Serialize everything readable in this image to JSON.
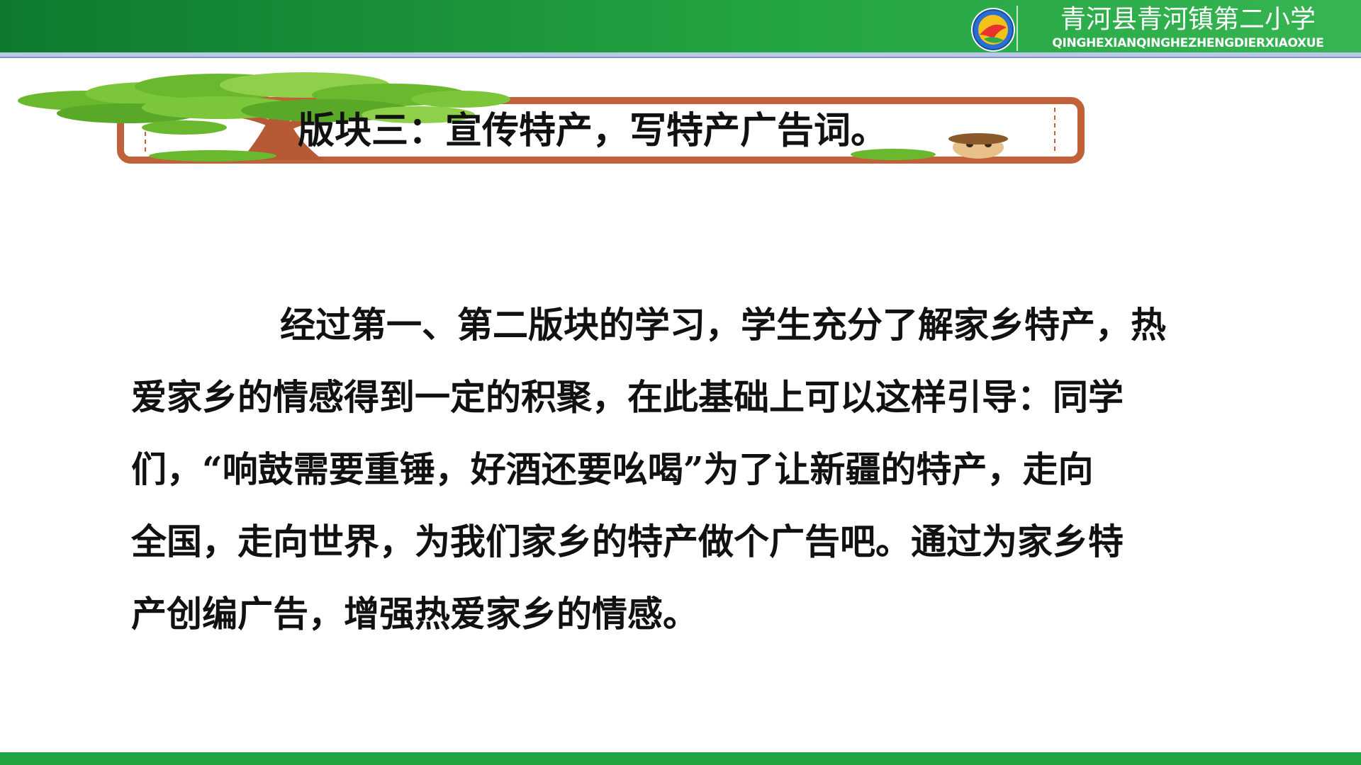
{
  "header": {
    "school_name": "青河县青河镇第二小学",
    "school_pinyin": "QINGHEXIANQINGHEZHENGDIERXIAOXUE",
    "logo_icon": "school-emblem-icon",
    "bar_color": "#23a442"
  },
  "banner": {
    "title": "版块三：宣传特产，写特产广告词。",
    "frame_color": "#c0613a",
    "tree_color": "#6ab82e"
  },
  "body": {
    "lines": [
      "经过第一、第二版块的学习，学生充分了解家乡特产，热",
      "爱家乡的情感得到一定的积聚，在此基础上可以这样引导：同学",
      "们，“响鼓需要重锤，好酒还要吆喝”为了让新疆的特产，走向",
      "全国，走向世界，为我们家乡的特产做个广告吧。通过为家乡特",
      "产创编广告，增强热爱家乡的情感。"
    ]
  },
  "footer": {
    "bar_color": "#23a442"
  }
}
